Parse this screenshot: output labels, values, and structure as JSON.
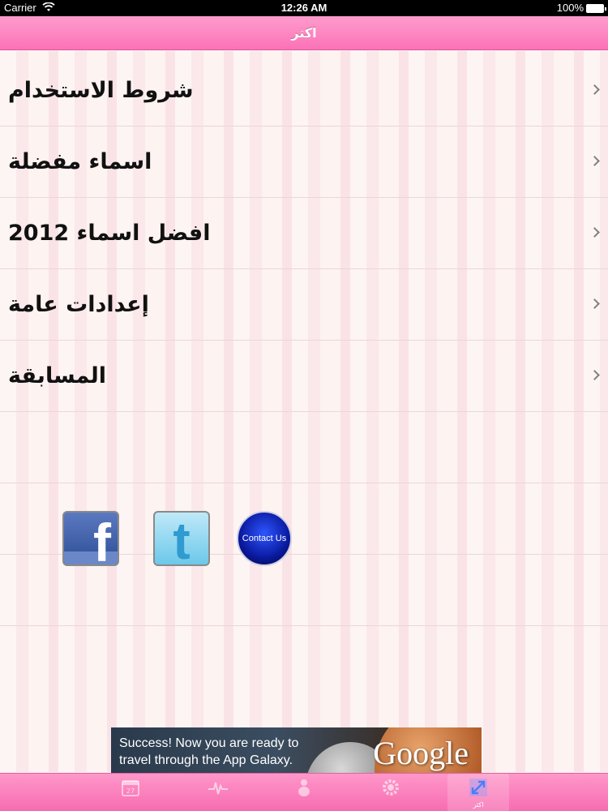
{
  "status_bar": {
    "carrier": "Carrier",
    "time": "12:26 AM",
    "battery": "100%"
  },
  "nav": {
    "title": "اكثر"
  },
  "menu": {
    "items": [
      {
        "label": "شروط الاستخدام"
      },
      {
        "label": "اسماء مفضلة"
      },
      {
        "label": "افضل اسماء 2012"
      },
      {
        "label": "إعدادات عامة"
      },
      {
        "label": "المسابقة"
      }
    ]
  },
  "social": {
    "facebook_glyph": "f",
    "twitter_glyph": "t",
    "contact_label": "Contact Us"
  },
  "ad": {
    "text": "Success! Now you are ready to travel through the App Galaxy.",
    "brand": "Google"
  },
  "tabs": {
    "active_index": 4,
    "items": [
      {
        "label": "",
        "icon": "calendar-icon"
      },
      {
        "label": "",
        "icon": "heartbeat-icon"
      },
      {
        "label": "",
        "icon": "baby-icon"
      },
      {
        "label": "",
        "icon": "gear-icon"
      },
      {
        "label": "اكثر",
        "icon": "expand-arrows-icon"
      }
    ]
  },
  "colors": {
    "nav_pink": "#fc72b7",
    "tab_pink": "#f76cb2",
    "row_divider": "#ecd6d9"
  }
}
